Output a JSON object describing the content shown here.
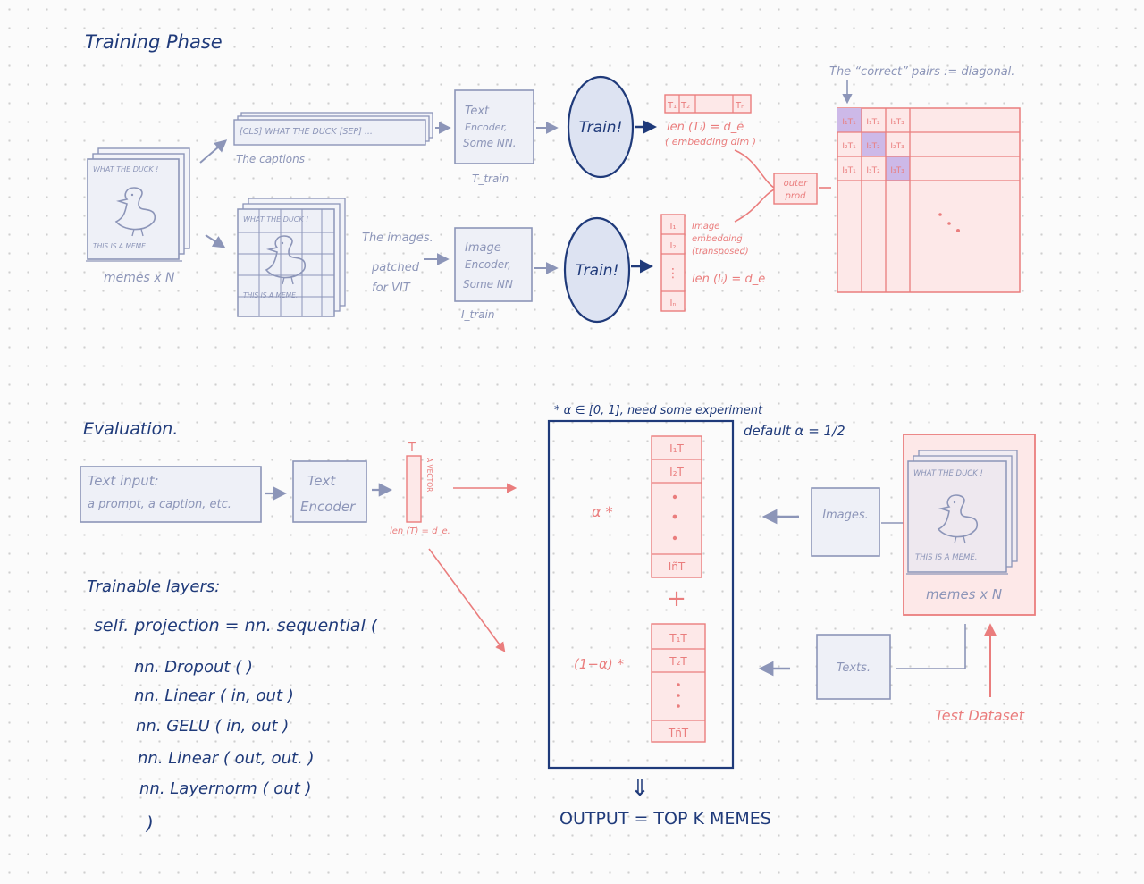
{
  "training": {
    "title": "Training Phase",
    "meme": {
      "top": "WHAT THE DUCK !",
      "bottom": "THIS IS A MEME."
    },
    "memes_label": "memes x N",
    "caption_strip": "[CLS] WHAT THE DUCK [SEP] ...",
    "captions_label": "The captions",
    "images_note": [
      "The images.",
      "patched",
      "for VIT"
    ],
    "text_encoder": [
      "Text",
      "Encoder,",
      "Some NN."
    ],
    "t_train": "T_train",
    "image_encoder": [
      "Image",
      "Encoder,",
      "Some NN"
    ],
    "i_train": "I_train",
    "train_label": "Train!",
    "t_vector": [
      "T₁",
      "T₂",
      "Tₙ"
    ],
    "len_t": "len (Tᵢ) = d_e",
    "embedding_dim": "( embedding dim )",
    "i_vector": [
      "I₁",
      "I₂",
      "⋮",
      "Iₙ"
    ],
    "image_embedding": [
      "Image",
      "embedding",
      "(transposed)"
    ],
    "len_i": "len (Iᵢ) = d_e",
    "outer_prod": [
      "outer",
      "prod"
    ],
    "diagonal_note": "The “correct” pairs := diagonal.",
    "matrix_rows": [
      [
        "I₁T₁",
        "I₁T₂",
        "I₁T₃"
      ],
      [
        "I₂T₁",
        "I₂T₂",
        "I₂T₃"
      ],
      [
        "I₃T₁",
        "I₃T₂",
        "I₃T₃"
      ]
    ]
  },
  "evaluation": {
    "title": "Evaluation.",
    "text_input": [
      "Text input:",
      "a prompt, a caption, etc."
    ],
    "text_encoder": [
      "Text",
      "Encoder"
    ],
    "vector_top": "T",
    "vector_side": "A VECTOR",
    "vector_len": "len (T) = d_e.",
    "alpha_note": "* α ∈ [0, 1], need some experiment",
    "default_alpha": "default  α = 1/2",
    "alpha_label": "α *",
    "one_minus_alpha": "(1−α) *",
    "plus": "+",
    "image_col": [
      "I₁T",
      "I₂T",
      "IñT"
    ],
    "text_col": [
      "T₁T",
      "T₂T",
      "TñT"
    ],
    "images_box": "Images.",
    "texts_box": "Texts.",
    "memes_label": "memes x N",
    "test_dataset": "Test Dataset",
    "output": "OUTPUT = TOP K MEMES",
    "down_arrow": "⇓"
  },
  "trainable": {
    "title": "Trainable layers:",
    "lines": [
      "self. projection = nn. sequential (",
      "nn. Dropout (   )",
      "nn. Linear ( in,     out       )",
      "nn. GELU ( in, out )",
      "nn. Linear ( out, out. )",
      "nn. Layernorm ( out )",
      ")"
    ]
  },
  "colors": {
    "navy": "#1f3a7a",
    "gray": "#8c95b8",
    "pink": "#ea7d7d",
    "pink_fill": "#fde8e8",
    "gray_fill": "#eef0f7",
    "purple": "#cdb9e8"
  },
  "icons": [
    "duck-icon",
    "arrow-icon",
    "down-double-arrow-icon"
  ]
}
